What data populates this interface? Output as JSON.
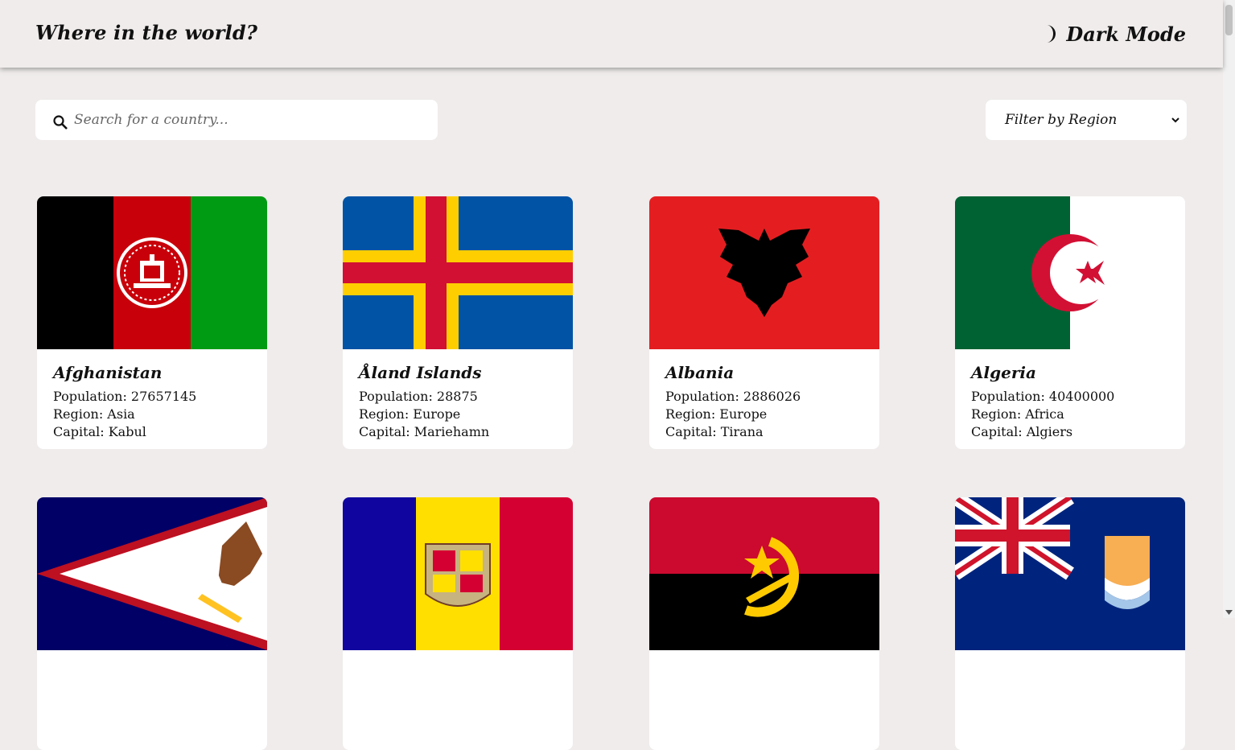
{
  "header": {
    "title": "Where in the world?",
    "dark_mode_label": "Dark Mode"
  },
  "search": {
    "placeholder": "Search for a country..."
  },
  "filter": {
    "selected": "Filter by Region"
  },
  "labels": {
    "population": "Population:",
    "region": "Region:",
    "capital": "Capital:"
  },
  "countries": [
    {
      "name": "Afghanistan",
      "population": "27657145",
      "region": "Asia",
      "capital": "Kabul",
      "flag": "afghanistan-flag"
    },
    {
      "name": "Åland Islands",
      "population": "28875",
      "region": "Europe",
      "capital": "Mariehamn",
      "flag": "aland-flag"
    },
    {
      "name": "Albania",
      "population": "2886026",
      "region": "Europe",
      "capital": "Tirana",
      "flag": "albania-flag"
    },
    {
      "name": "Algeria",
      "population": "40400000",
      "region": "Africa",
      "capital": "Algiers",
      "flag": "algeria-flag"
    },
    {
      "flag": "american-samoa-flag"
    },
    {
      "flag": "andorra-flag"
    },
    {
      "flag": "angola-flag"
    },
    {
      "flag": "anguilla-flag"
    }
  ],
  "colors": {
    "background": "#efeceb",
    "card": "#ffffff"
  }
}
